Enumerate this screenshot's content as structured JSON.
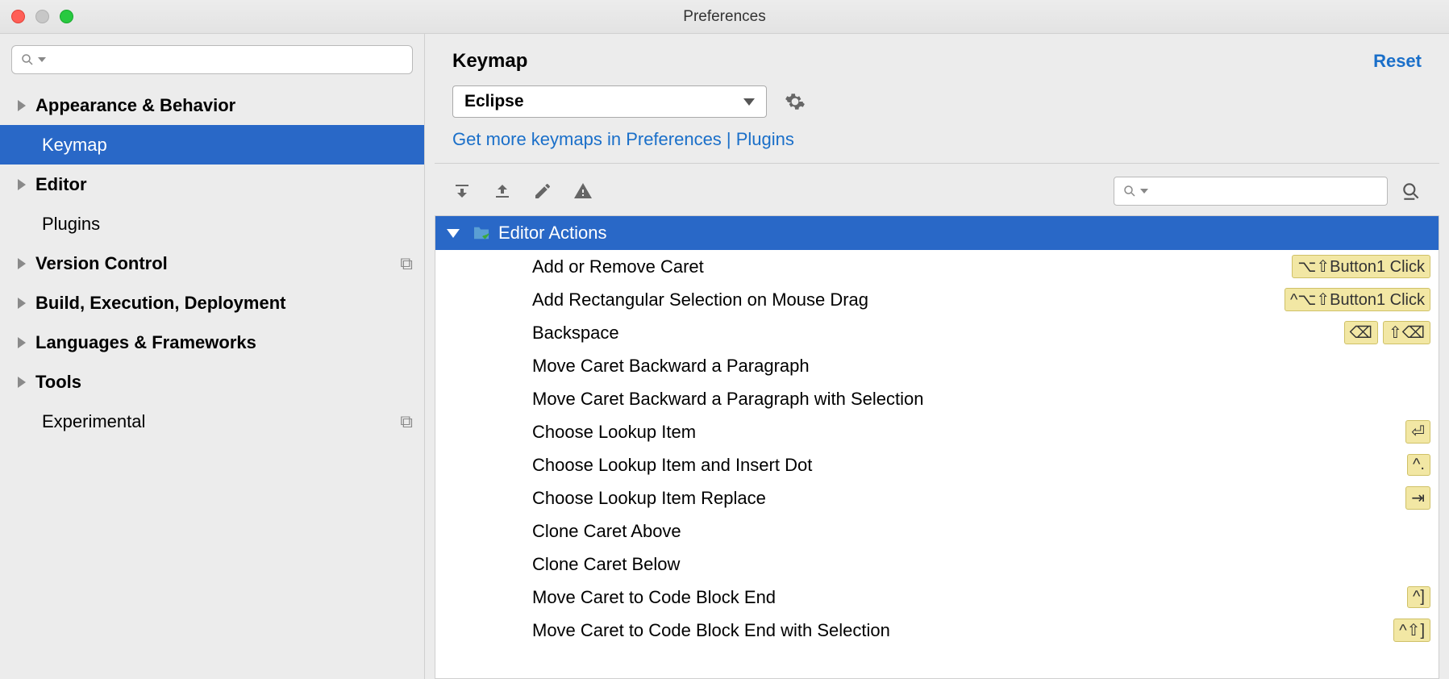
{
  "title": "Preferences",
  "sidebar": {
    "items": [
      {
        "label": "Appearance & Behavior",
        "expandable": true,
        "indent": false,
        "selected": false,
        "trailing": ""
      },
      {
        "label": "Keymap",
        "expandable": false,
        "indent": true,
        "selected": true,
        "trailing": ""
      },
      {
        "label": "Editor",
        "expandable": true,
        "indent": false,
        "selected": false,
        "trailing": ""
      },
      {
        "label": "Plugins",
        "expandable": false,
        "indent": true,
        "selected": false,
        "trailing": ""
      },
      {
        "label": "Version Control",
        "expandable": true,
        "indent": false,
        "selected": false,
        "trailing": "⧉"
      },
      {
        "label": "Build, Execution, Deployment",
        "expandable": true,
        "indent": false,
        "selected": false,
        "trailing": ""
      },
      {
        "label": "Languages & Frameworks",
        "expandable": true,
        "indent": false,
        "selected": false,
        "trailing": ""
      },
      {
        "label": "Tools",
        "expandable": true,
        "indent": false,
        "selected": false,
        "trailing": ""
      },
      {
        "label": "Experimental",
        "expandable": false,
        "indent": true,
        "selected": false,
        "trailing": "⧉"
      }
    ]
  },
  "main": {
    "title": "Keymap",
    "reset": "Reset",
    "keymap_name": "Eclipse",
    "hint": "Get more keymaps in Preferences | Plugins",
    "group_title": "Editor Actions",
    "actions": [
      {
        "label": "Add or Remove Caret",
        "shortcuts": [
          "⌥⇧Button1 Click"
        ]
      },
      {
        "label": "Add Rectangular Selection on Mouse Drag",
        "shortcuts": [
          "^⌥⇧Button1 Click"
        ]
      },
      {
        "label": "Backspace",
        "shortcuts": [
          "⌫",
          "⇧⌫"
        ]
      },
      {
        "label": "Move Caret Backward a Paragraph",
        "shortcuts": []
      },
      {
        "label": "Move Caret Backward a Paragraph with Selection",
        "shortcuts": []
      },
      {
        "label": "Choose Lookup Item",
        "shortcuts": [
          "⏎"
        ]
      },
      {
        "label": "Choose Lookup Item and Insert Dot",
        "shortcuts": [
          "^."
        ]
      },
      {
        "label": "Choose Lookup Item Replace",
        "shortcuts": [
          "⇥"
        ]
      },
      {
        "label": "Clone Caret Above",
        "shortcuts": []
      },
      {
        "label": "Clone Caret Below",
        "shortcuts": []
      },
      {
        "label": "Move Caret to Code Block End",
        "shortcuts": [
          "^]"
        ]
      },
      {
        "label": "Move Caret to Code Block End with Selection",
        "shortcuts": [
          "^⇧]"
        ]
      }
    ]
  }
}
